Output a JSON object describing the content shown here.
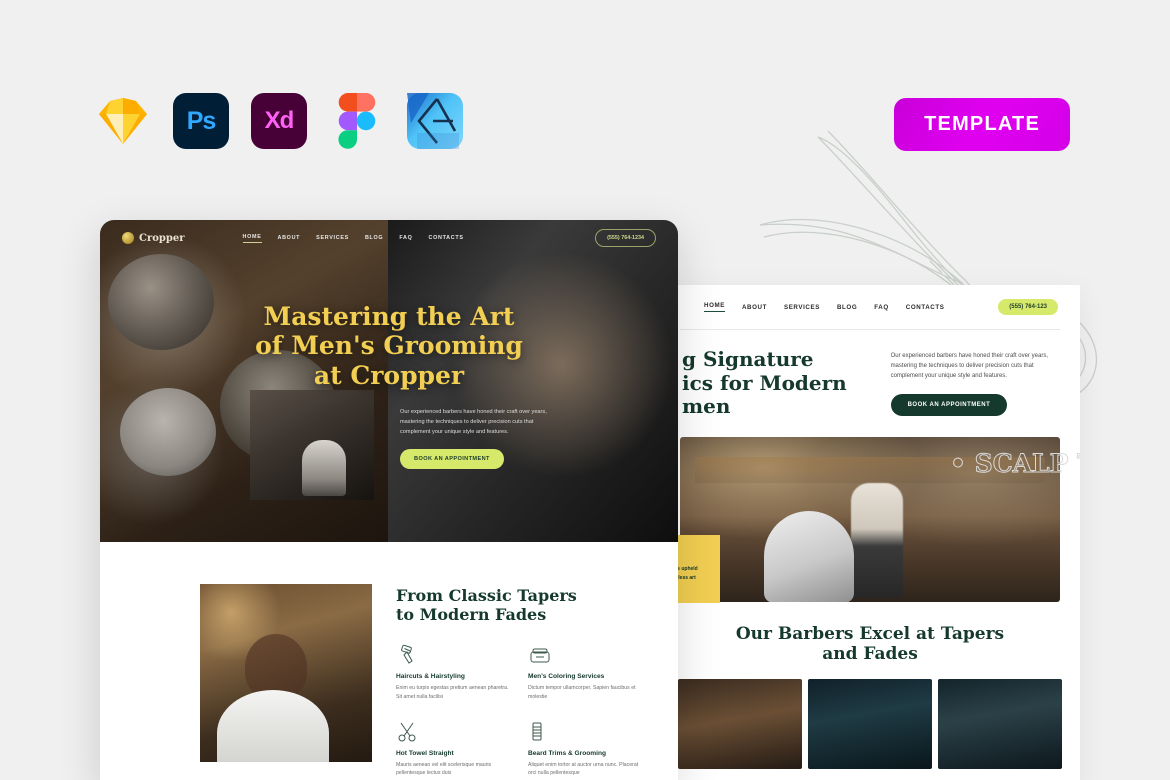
{
  "badge": {
    "label": "TEMPLATE"
  },
  "app_icons": [
    {
      "name": "sketch-icon",
      "label": "Sketch"
    },
    {
      "name": "photoshop-icon",
      "label": "Ps"
    },
    {
      "name": "xd-icon",
      "label": "Xd"
    },
    {
      "name": "figma-icon",
      "label": "Figma"
    },
    {
      "name": "affinity-icon",
      "label": "Affinity Designer"
    }
  ],
  "colors": {
    "badge_magenta": "#d400e8",
    "gold": "#f2cf52",
    "dark_green": "#15392c",
    "lime": "#d6e96a",
    "page_bg": "#f0f0f0"
  },
  "mockup_dark": {
    "logo": "Cropper",
    "nav": [
      {
        "label": "HOME",
        "active": true
      },
      {
        "label": "ABOUT",
        "active": false
      },
      {
        "label": "SERVICES",
        "active": false,
        "caret": "▾"
      },
      {
        "label": "BLOG",
        "active": false
      },
      {
        "label": "FAQ",
        "active": false
      },
      {
        "label": "CONTACTS",
        "active": false
      }
    ],
    "phone": "(555) 764-1234",
    "hero_title_line1": "Mastering the Art",
    "hero_title_line2": "of Men's Grooming",
    "hero_title_line3": "at Cropper",
    "hero_body": "Our experienced barbers have honed their craft over years, mastering the techniques to deliver precision cuts that complement your unique style and features.",
    "hero_button": "BOOK AN APPOINTMENT",
    "services_title_line1": "From Classic Tapers",
    "services_title_line2": "to Modern Fades",
    "services": [
      {
        "icon": "clipper-icon",
        "title": "Haircuts & Hairstyling",
        "body": "Enim eu turpis egestas pretium aenean pharetra. Sit amet nulla facilisi"
      },
      {
        "icon": "pomade-jar-icon",
        "title": "Men's Coloring Services",
        "body": "Dictum tempor ullamcorper. Sapien faucibus et molestie"
      },
      {
        "icon": "scissors-icon",
        "title": "Hot Towel Straight",
        "body": "Mauris aenean vel elit scelerisque mauris pellentesque lectus duis"
      },
      {
        "icon": "razor-icon",
        "title": "Beard Trims & Grooming",
        "body": "Aliquet enim tortor at auctor urna nunc. Placerat orci nulla pellentesque"
      }
    ]
  },
  "mockup_light": {
    "nav": [
      {
        "label": "HOME",
        "active": true
      },
      {
        "label": "ABOUT",
        "active": false
      },
      {
        "label": "SERVICES",
        "active": false,
        "caret": "▾"
      },
      {
        "label": "BLOG",
        "active": false
      },
      {
        "label": "FAQ",
        "active": false
      },
      {
        "label": "CONTACTS",
        "active": false
      }
    ],
    "phone": "(555) 764-123",
    "hero_title_line1": "g Signature",
    "hero_title_line2": "ics for Modern",
    "hero_title_line3": "men",
    "hero_body": "Our experienced barbers have honed their craft over years, mastering the techniques to deliver precision cuts that complement your unique style and features.",
    "hero_button": "BOOK AN APPOINTMENT",
    "yellow_card": "r has upheld timeless art",
    "outline_marquee": "• SCALP TREATMENT • LINE-UP",
    "gallery_title_line1": "Our Barbers Excel at Tapers",
    "gallery_title_line2": "and Fades"
  }
}
